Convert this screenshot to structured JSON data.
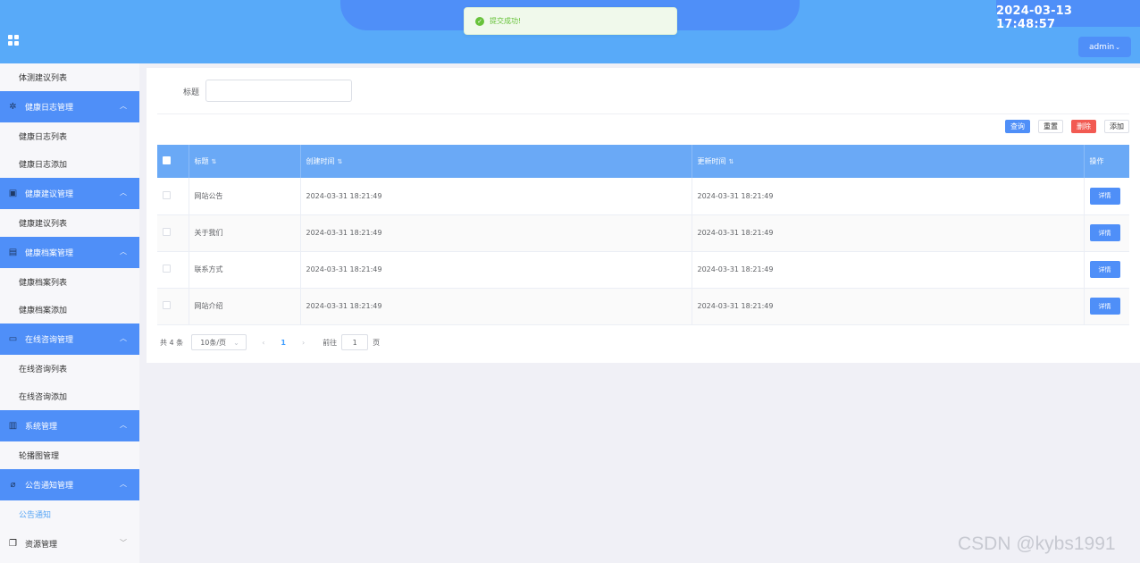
{
  "header": {
    "clock": "2024-03-13 17:48:57",
    "user_label": "admin",
    "user_chevron": "⌄"
  },
  "toast": {
    "icon": "✓",
    "message": "提交成功!"
  },
  "sidebar": {
    "top_item": "体测建议列表",
    "groups": [
      {
        "label": "健康日志管理",
        "icon": "gear-icon",
        "items": [
          "健康日志列表",
          "健康日志添加"
        ]
      },
      {
        "label": "健康建议管理",
        "icon": "inbox-icon",
        "items": [
          "健康建议列表"
        ]
      },
      {
        "label": "健康档案管理",
        "icon": "clipboard-icon",
        "items": [
          "健康档案列表",
          "健康档案添加"
        ]
      },
      {
        "label": "在线咨询管理",
        "icon": "chat-icon",
        "items": [
          "在线咨询列表",
          "在线咨询添加"
        ]
      },
      {
        "label": "系统管理",
        "icon": "box-icon",
        "items": [
          "轮播图管理"
        ]
      },
      {
        "label": "公告通知管理",
        "icon": "paperclip-icon",
        "items": [
          "公告通知"
        ]
      },
      {
        "label": "资源管理",
        "icon": "copy-icon",
        "items": []
      }
    ]
  },
  "filter": {
    "label": "标题",
    "value": ""
  },
  "buttons": {
    "query": "查询",
    "reset": "重置",
    "delete": "删除",
    "add": "添加"
  },
  "table": {
    "columns": [
      "标题",
      "创建时间",
      "更新时间",
      "操作"
    ],
    "rows": [
      {
        "title": "网站公告",
        "created": "2024-03-31 18:21:49",
        "updated": "2024-03-31 18:21:49",
        "action": "详情"
      },
      {
        "title": "关于我们",
        "created": "2024-03-31 18:21:49",
        "updated": "2024-03-31 18:21:49",
        "action": "详情"
      },
      {
        "title": "联系方式",
        "created": "2024-03-31 18:21:49",
        "updated": "2024-03-31 18:21:49",
        "action": "详情"
      },
      {
        "title": "网站介绍",
        "created": "2024-03-31 18:21:49",
        "updated": "2024-03-31 18:21:49",
        "action": "详情"
      }
    ]
  },
  "pagination": {
    "total": "共 4 条",
    "page_size": "10条/页",
    "prev": "‹",
    "current": "1",
    "next": "›",
    "goto_label": "前往",
    "goto_value": "1",
    "goto_suffix": "页"
  },
  "watermark": "CSDN @kybs1991",
  "colors": {
    "primary": "#4f8ff8",
    "header": "#58aaf9",
    "danger": "#f25a52",
    "success": "#67c23a"
  }
}
